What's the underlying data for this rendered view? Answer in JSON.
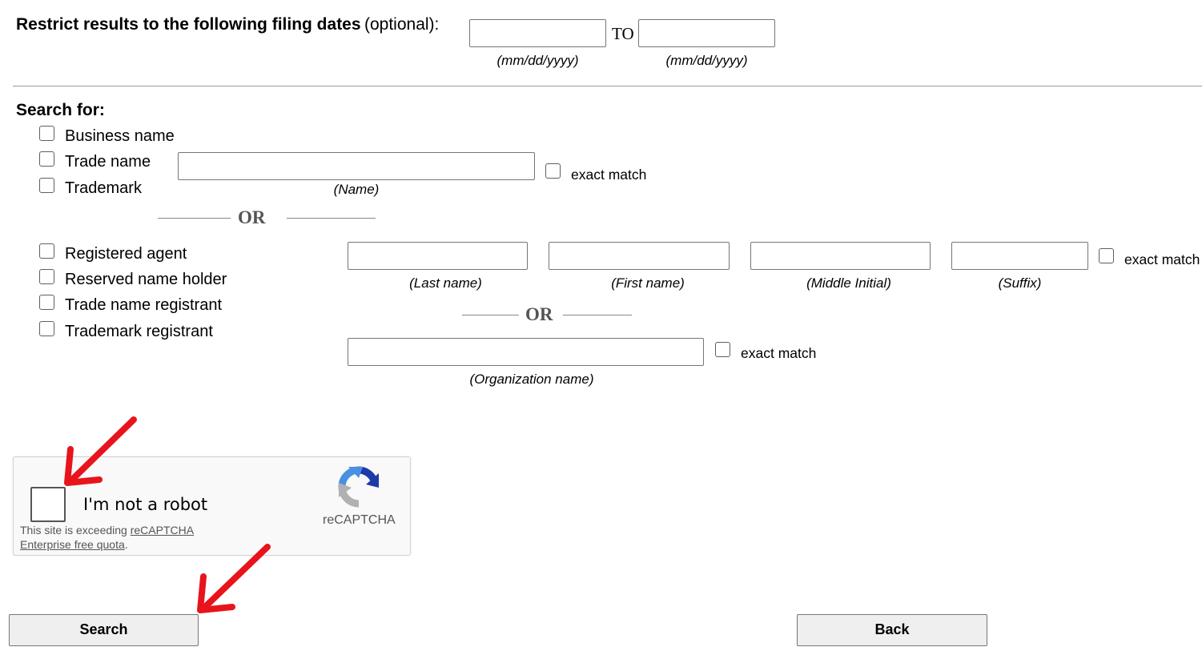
{
  "filing_dates": {
    "label_bold": "Restrict results to the following filing dates",
    "label_optional": "(optional):",
    "from_value": "",
    "to_text": "TO",
    "to_value": "",
    "from_hint": "(mm/dd/yyyy)",
    "to_hint": "(mm/dd/yyyy)"
  },
  "search_for": {
    "heading": "Search for:",
    "name_types": [
      {
        "label": "Business name",
        "checked": false
      },
      {
        "label": "Trade name",
        "checked": false
      },
      {
        "label": "Trademark",
        "checked": false
      }
    ],
    "name_value": "",
    "name_hint": "(Name)",
    "name_exact": "exact match",
    "or_1": "OR",
    "person_types": [
      {
        "label": "Registered agent",
        "checked": false
      },
      {
        "label": "Reserved name holder",
        "checked": false
      },
      {
        "label": "Trade name registrant",
        "checked": false
      },
      {
        "label": "Trademark registrant",
        "checked": false
      }
    ],
    "last_name_hint": "(Last name)",
    "first_name_hint": "(First name)",
    "middle_initial_hint": "(Middle Initial)",
    "suffix_hint": "(Suffix)",
    "person_exact": "exact match",
    "or_2": "OR",
    "org_value": "",
    "org_hint": "(Organization name)",
    "org_exact": "exact match"
  },
  "recaptcha": {
    "label": "I'm not a robot",
    "notice_prefix": "This site is exceeding ",
    "notice_link": "reCAPTCHA Enterprise free quota",
    "notice_suffix": ".",
    "brand": "reCAPTCHA",
    "checked": false
  },
  "buttons": {
    "search": "Search",
    "back": "Back"
  },
  "colors": {
    "annotation_arrow": "#e8141c",
    "recaptcha_blue": "#4a90e2",
    "recaptcha_gray": "#b1b1b1"
  }
}
